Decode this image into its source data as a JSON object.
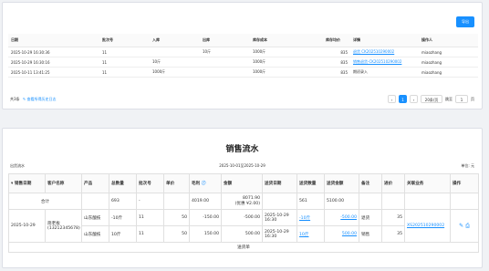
{
  "top": {
    "export_label": "导出",
    "columns": [
      "日期",
      "批次号",
      "入库",
      "出库",
      "库存成本",
      "库存均价",
      "详情",
      "操作人"
    ],
    "rows": [
      [
        "2025-10-29 16:30:36",
        "11",
        "",
        "10斤",
        "1000斤",
        "835",
        "退货 CK202510290002",
        "miaozhang"
      ],
      [
        "2025-10-29 16:30:16",
        "11",
        "10斤",
        "",
        "1000斤",
        "835",
        "销售退货-CK202510290002",
        "miaozhang"
      ],
      [
        "2025-10-11 13:41:25",
        "11",
        "1000斤",
        "",
        "1000斤",
        "835",
        "期初录入",
        "miaozhang"
      ]
    ],
    "total_text": "共3条",
    "total_link": "查看所得历史日志",
    "pager": {
      "prev": "‹",
      "current": "1",
      "next": "›",
      "page_size": "20条/页",
      "goto_label": "跳至",
      "goto_value": "1",
      "goto_suffix": "页"
    }
  },
  "report": {
    "title": "销售流水",
    "unit_left": "出货流水",
    "date_range": "2025-10-01至2025-10-29",
    "unit_right": "单位: 元",
    "columns": [
      "销售日期",
      "客户名称",
      "产品",
      "总数量",
      "批次号",
      "单价",
      "毛利",
      "金额",
      "送货日期",
      "送货数量",
      "送货金额",
      "备注",
      "进价",
      "关联业务",
      "操作"
    ],
    "sort_icon": "▾",
    "total_row": {
      "label": "合计",
      "qty": "693",
      "batch": "-",
      "profit": "4019.00",
      "amount": "8071.90",
      "amount_sub": "(优惠 ¥2.00)",
      "del_qty": "561",
      "del_amount": "5100.00"
    },
    "rows": [
      {
        "date": "2025-10-29",
        "customer": "简老板(13212345678)",
        "product": "山东酸枝",
        "qty": "-10斤",
        "batch": "11",
        "price": "50",
        "profit": "-150.00",
        "amount": "-500.00",
        "del_date": "2025-10-29 16:30",
        "del_qty": "-10斤",
        "del_amount": "-500.00",
        "note": "退货",
        "cost": "35",
        "biz": "",
        "ops": ""
      },
      {
        "date": "",
        "customer": "",
        "product": "山东酸枝",
        "qty": "10斤",
        "batch": "11",
        "price": "50",
        "profit": "150.00",
        "amount": "500.00",
        "del_date": "2025-10-29 16:30",
        "del_qty": "10斤",
        "del_amount": "500.00",
        "note": "销售",
        "cost": "35",
        "biz": "XS202510290002",
        "ops": "✎ ⎙"
      }
    ],
    "footer_text": "送货单"
  }
}
